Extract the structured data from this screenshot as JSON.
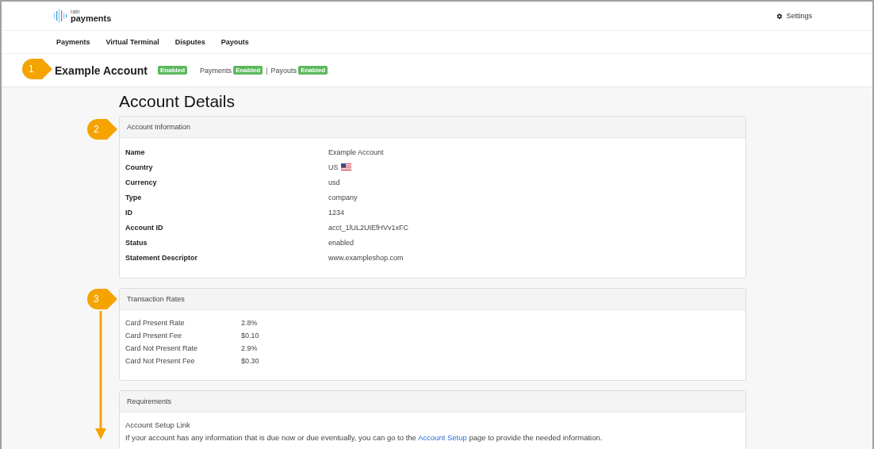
{
  "logo": {
    "small": "rain",
    "name": "payments"
  },
  "settings": {
    "label": "Settings"
  },
  "nav": [
    {
      "label": "Payments"
    },
    {
      "label": "Virtual Terminal"
    },
    {
      "label": "Disputes"
    },
    {
      "label": "Payouts"
    }
  ],
  "account_bar": {
    "name": "Example Account",
    "status": "Enabled",
    "items": [
      {
        "label": "Payments",
        "status": "Enabled"
      },
      {
        "label": "Payouts",
        "status": "Enabled"
      }
    ],
    "separator": "|"
  },
  "page_title": "Account Details",
  "account_information": {
    "title": "Account Information",
    "rows": [
      {
        "label": "Name",
        "value": "Example Account"
      },
      {
        "label": "Country",
        "value": "US",
        "kind": "flag"
      },
      {
        "label": "Currency",
        "value": "usd"
      },
      {
        "label": "Type",
        "value": "company"
      },
      {
        "label": "ID",
        "value": "1234"
      },
      {
        "label": "Account ID",
        "value": "acct_1lUL2UIEfHVv1xFC"
      },
      {
        "label": "Status",
        "value": "enabled"
      },
      {
        "label": "Statement Descriptor",
        "value": "www.exampleshop.com"
      }
    ]
  },
  "transaction_rates": {
    "title": "Transaction Rates",
    "rows": [
      {
        "label": "Card Present Rate",
        "value": "2.8%"
      },
      {
        "label": "Card Present Fee",
        "value": "$0.10"
      },
      {
        "label": "Card Not Present Rate",
        "value": "2.9%"
      },
      {
        "label": "Card Not Present Fee",
        "value": "$0.30"
      }
    ]
  },
  "requirements": {
    "title": "Requirements",
    "subtitle": "Account Setup Link",
    "text_before": "If your account has any information that is due now or due eventually, you can go to the",
    "link": "Account Setup",
    "text_after": "page to provide the needed information."
  },
  "callouts": [
    "1",
    "2",
    "3"
  ]
}
